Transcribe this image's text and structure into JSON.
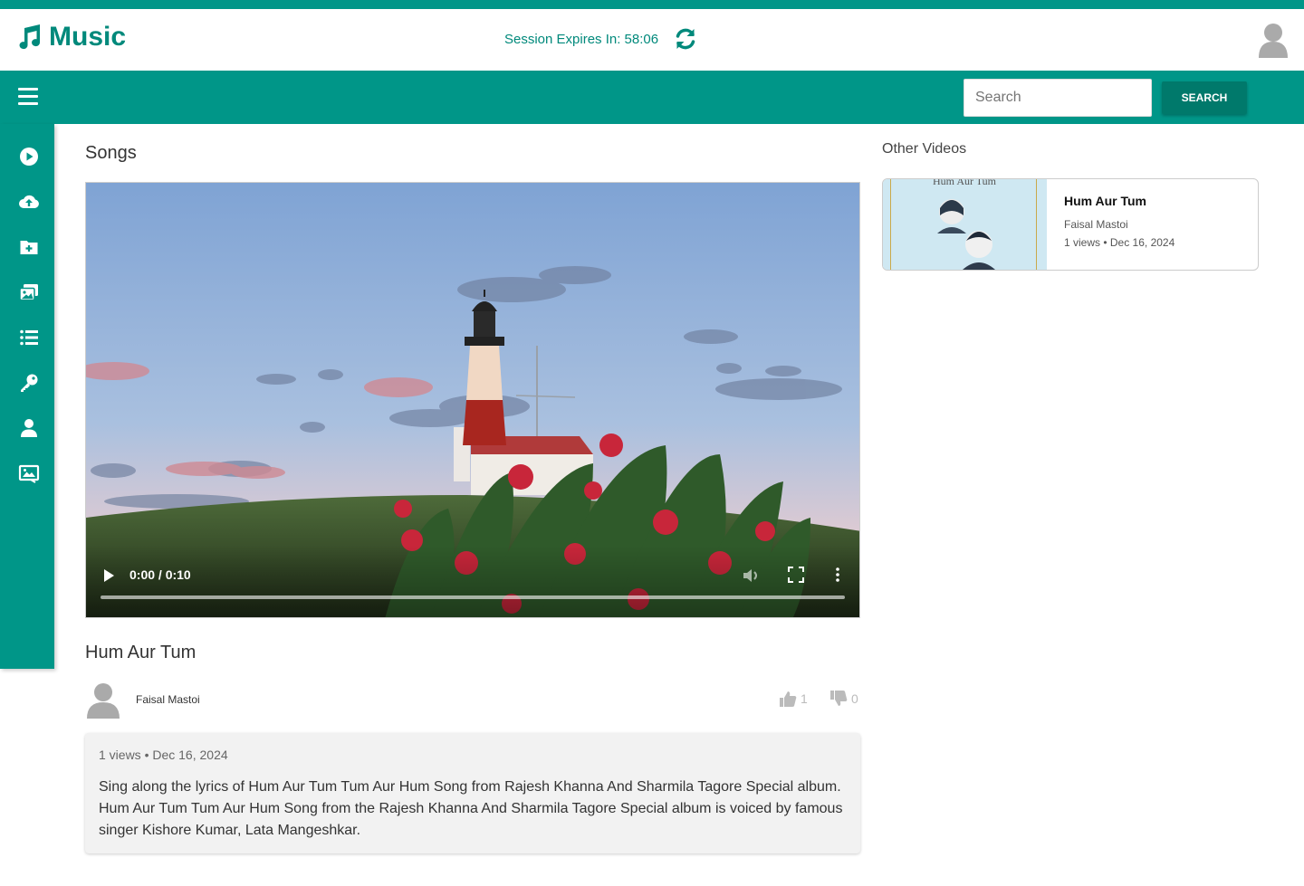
{
  "app": {
    "name": "Music"
  },
  "session": {
    "text": "Session Expires In: 58:06"
  },
  "search": {
    "placeholder": "Search",
    "button_label": "SEARCH"
  },
  "sidebar": {
    "items": [
      {
        "icon": "play-circle-icon"
      },
      {
        "icon": "cloud-upload-icon"
      },
      {
        "icon": "folder-plus-icon"
      },
      {
        "icon": "images-icon"
      },
      {
        "icon": "list-icon"
      },
      {
        "icon": "key-icon"
      },
      {
        "icon": "user-icon"
      },
      {
        "icon": "image-gallery-icon"
      }
    ]
  },
  "main": {
    "heading": "Songs",
    "player": {
      "time": "0:00 / 0:10",
      "progress": 0
    },
    "song": {
      "title": "Hum Aur Tum",
      "uploader": "Faisal Mastoi",
      "likes": "1",
      "dislikes": "0",
      "meta": "1 views • Dec 16, 2024",
      "description": "Sing along the lyrics of Hum Aur Tum Tum Aur Hum Song from Rajesh Khanna And Sharmila Tagore Special album. Hum Aur Tum Tum Aur Hum Song from the Rajesh Khanna And Sharmila Tagore Special album is voiced by famous singer Kishore Kumar, Lata Mangeshkar."
    }
  },
  "other_videos": {
    "heading": "Other Videos",
    "items": [
      {
        "thumb_text": "Hum Aur Tum",
        "title": "Hum Aur Tum",
        "artist": "Faisal Mastoi",
        "meta": "1 views • Dec 16, 2024"
      }
    ]
  },
  "colors": {
    "primary": "#009688",
    "primary_dark": "#00796b",
    "accent_text": "#00897b"
  }
}
